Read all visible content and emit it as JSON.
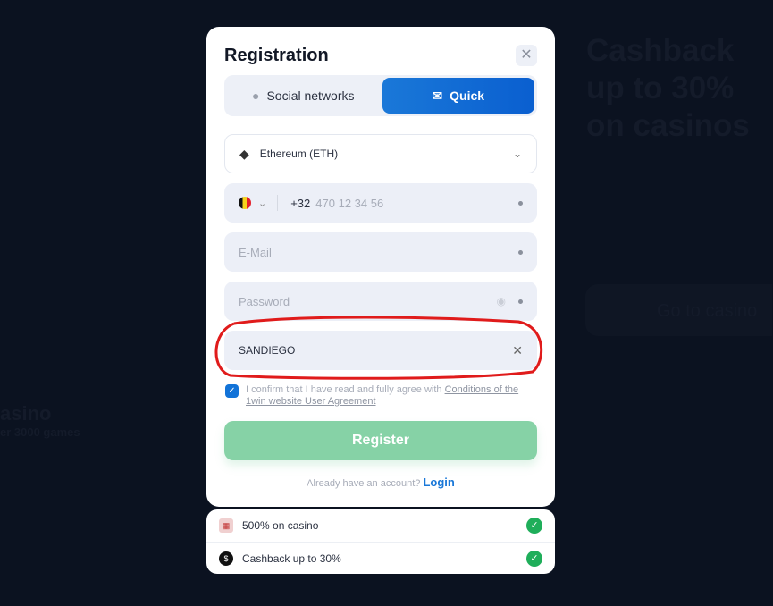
{
  "background": {
    "headline": "Cashback up to 30% on casinos",
    "button": "Go to casino",
    "casino": "asino",
    "casino_sub": "er 3000 games"
  },
  "modal": {
    "title": "Registration",
    "tabs": [
      {
        "label": "Social networks",
        "icon": "chat-bubbles-icon"
      },
      {
        "label": "Quick",
        "icon": "envelope-icon",
        "active": true
      }
    ],
    "currency": {
      "value": "Ethereum (ETH)",
      "icon": "ethereum-icon"
    },
    "phone": {
      "country_code": "+32",
      "placeholder": "470 12 34 56",
      "flag": "belgium"
    },
    "email": {
      "placeholder": "E-Mail"
    },
    "password": {
      "placeholder": "Password"
    },
    "promo": {
      "value": "SANDIEGO"
    },
    "agreement": {
      "checked": true,
      "text": "I confirm that I have read and fully agree with ",
      "link": "Conditions of the 1win website User Agreement"
    },
    "register_label": "Register",
    "login_prompt": "Already have an account?",
    "login_link": "Login"
  },
  "bonuses": [
    {
      "label": "500% on casino",
      "icon": "casino-icon"
    },
    {
      "label": "Cashback up to 30%",
      "icon": "cashback-icon"
    }
  ],
  "colors": {
    "accent": "#1a78d8",
    "register": "#86d2a6",
    "check": "#1fae5a",
    "annotation": "#e01b1b"
  }
}
